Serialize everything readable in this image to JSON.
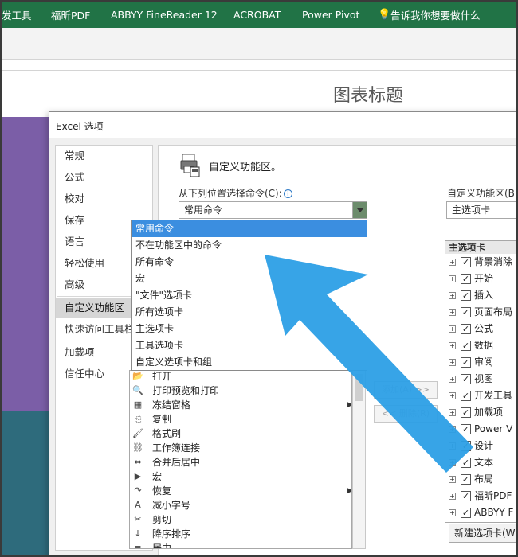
{
  "ribbon": {
    "tabs": [
      "发工具",
      "福昕PDF",
      "ABBYY FineReader 12",
      "ACROBAT",
      "Power Pivot",
      "告诉我你想要做什么"
    ]
  },
  "sheet": {
    "chart_title": "图表标题"
  },
  "dialog": {
    "title": "Excel 选项",
    "nav": [
      "常规",
      "公式",
      "校对",
      "保存",
      "语言",
      "轻松使用",
      "高级",
      "自定义功能区",
      "快速访问工具栏",
      "加载项",
      "信任中心"
    ],
    "active_nav": "自定义功能区",
    "section_title": "自定义功能区。",
    "choose_label": "从下列位置选择命令(C):",
    "choose_value": "常用命令",
    "customize_label": "自定义功能区(B",
    "customize_value": "主选项卡",
    "dropdown_options": [
      "常用命令",
      "不在功能区中的命令",
      "所有命令",
      "宏",
      "\"文件\"选项卡",
      "所有选项卡",
      "主选项卡",
      "工具选项卡",
      "自定义选项卡和组"
    ],
    "commands": [
      {
        "icon": "folder-open-icon",
        "glyph": "📂",
        "label": "打开"
      },
      {
        "icon": "print-preview-icon",
        "glyph": "🔍",
        "label": "打印预览和打印"
      },
      {
        "icon": "freeze-panes-icon",
        "glyph": "▦",
        "label": "冻结窗格"
      },
      {
        "icon": "copy-icon",
        "glyph": "⎘",
        "label": "复制"
      },
      {
        "icon": "format-painter-icon",
        "glyph": "🖌",
        "label": "格式刷"
      },
      {
        "icon": "workbook-connections-icon",
        "glyph": "⛓",
        "label": "工作簿连接"
      },
      {
        "icon": "merge-center-icon",
        "glyph": "⇔",
        "label": "合并后居中"
      },
      {
        "icon": "macro-icon",
        "glyph": "▶",
        "label": "宏"
      },
      {
        "icon": "redo-icon",
        "glyph": "↷",
        "label": "恢复"
      },
      {
        "icon": "decrease-font-icon",
        "glyph": "A",
        "label": "减小字号"
      },
      {
        "icon": "cut-icon",
        "glyph": "✂",
        "label": "剪切"
      },
      {
        "icon": "sort-descending-icon",
        "glyph": "↓",
        "label": "降序排序"
      },
      {
        "icon": "center-icon",
        "glyph": "≡",
        "label": "居中"
      }
    ],
    "add_button": "添加(A) >>",
    "remove_button": "<< 删除(R)",
    "tree_header": "主选项卡",
    "tree_items": [
      "背景消除",
      "开始",
      "插入",
      "页面布局",
      "公式",
      "数据",
      "审阅",
      "视图",
      "开发工具",
      "加载项",
      "Power V",
      "设计",
      "文本",
      "布局",
      "福昕PDF",
      "ABBYY F"
    ],
    "new_tab_button": "新建选项卡(W"
  }
}
